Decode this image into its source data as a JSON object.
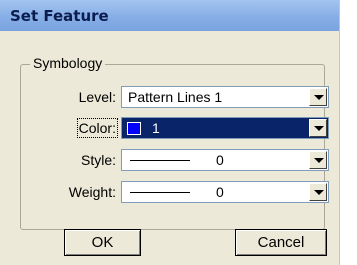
{
  "window": {
    "title": "Set Feature"
  },
  "groupbox": {
    "label": "Symbology"
  },
  "fields": {
    "level": {
      "label": "Level:",
      "value": "Pattern Lines 1"
    },
    "color": {
      "label": "Color:",
      "value": "1",
      "swatch_color": "#0000ff"
    },
    "style": {
      "label": "Style:",
      "value": "0"
    },
    "weight": {
      "label": "Weight:",
      "value": "0"
    }
  },
  "buttons": {
    "ok": "OK",
    "cancel": "Cancel"
  },
  "colors": {
    "selection": "#0a246a",
    "titlebar": "#86aee6",
    "dialog_bg": "#ece9d8"
  }
}
